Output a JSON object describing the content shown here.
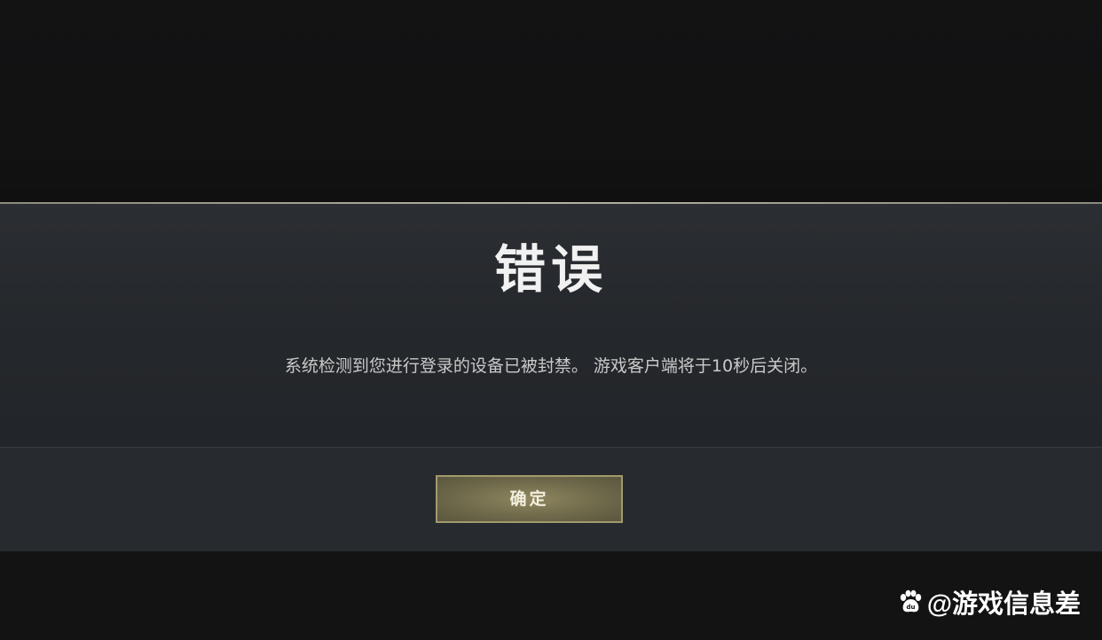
{
  "dialog": {
    "title": "错误",
    "message": "系统检测到您进行登录的设备已被封禁。 游戏客户端将于10秒后关闭。",
    "confirm_label": "确定"
  },
  "watermark": {
    "icon": "paw-icon",
    "text": "@游戏信息差"
  },
  "colors": {
    "background": "#121213",
    "dialog": "#25282c",
    "dialog_border": "#b4b1a6",
    "button_fill": "#7a7453",
    "button_border": "#a39a6b",
    "title_text": "#f1f1f1",
    "message_text": "#c9c9c9"
  }
}
